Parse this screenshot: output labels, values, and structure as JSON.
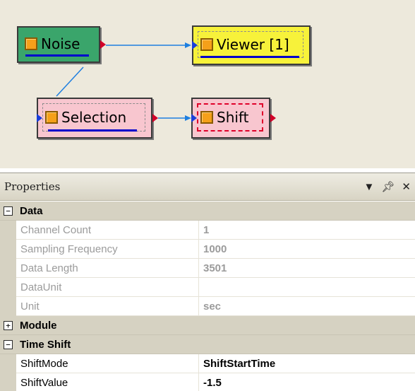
{
  "canvas": {
    "nodes": {
      "noise": {
        "label": "Noise"
      },
      "viewer": {
        "label": "Viewer [1]"
      },
      "selection": {
        "label": "Selection"
      },
      "shift": {
        "label": "Shift"
      }
    },
    "colors": {
      "background": "#ede9dc",
      "noise": "#3aa56b",
      "viewer": "#f7f23a",
      "selection": "#f8c6cf",
      "shift": "#f8c6cf",
      "wire": "#1e7fe0",
      "out_port": "#d10028",
      "in_port": "#1a3fd9"
    }
  },
  "properties": {
    "title": "Properties",
    "header_icons": [
      "dropdown-arrow-icon",
      "pin-icon",
      "close-icon"
    ],
    "categories": [
      {
        "label": "Data",
        "expanded": true,
        "rows": [
          {
            "name": "Channel Count",
            "value": "1",
            "enabled": false
          },
          {
            "name": "Sampling Frequency",
            "value": "1000",
            "enabled": false
          },
          {
            "name": "Data Length",
            "value": "3501",
            "enabled": false
          },
          {
            "name": "DataUnit",
            "value": "",
            "enabled": false
          },
          {
            "name": "Unit",
            "value": "sec",
            "enabled": false
          }
        ]
      },
      {
        "label": "Module",
        "expanded": false,
        "rows": []
      },
      {
        "label": "Time Shift",
        "expanded": true,
        "rows": [
          {
            "name": "ShiftMode",
            "value": "ShiftStartTime",
            "enabled": true
          },
          {
            "name": "ShiftValue",
            "value": "-1.5",
            "enabled": true
          }
        ]
      }
    ],
    "expander_glyphs": {
      "expanded": "−",
      "collapsed": "+"
    }
  }
}
